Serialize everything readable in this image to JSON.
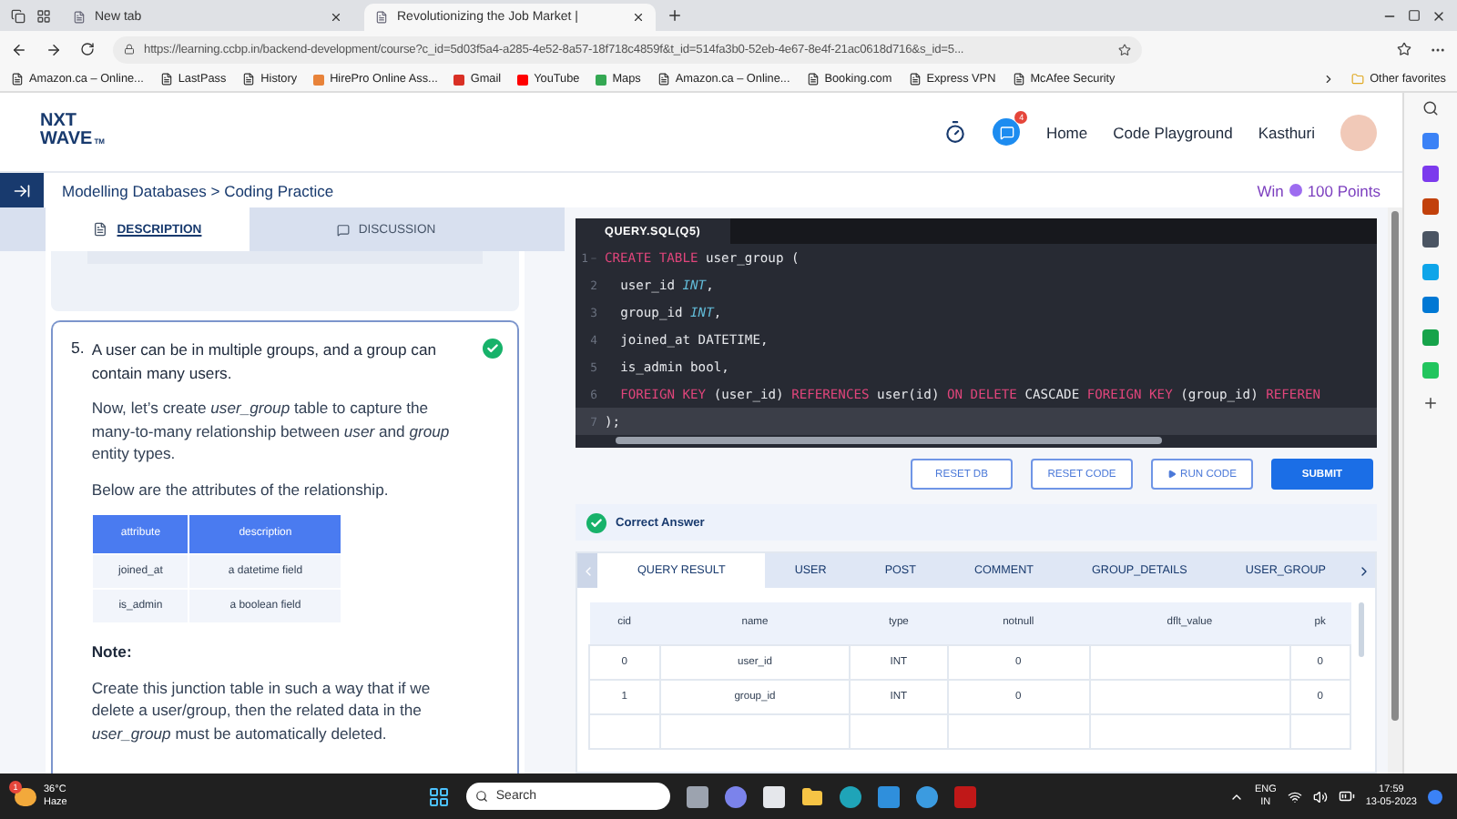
{
  "browser": {
    "tabs": [
      {
        "title": "New tab",
        "selected": false
      },
      {
        "title": "Revolutionizing the Job Market |",
        "selected": true
      }
    ],
    "url": "https://learning.ccbp.in/backend-development/course?c_id=5d03f5a4-a285-4e52-8a57-18f718c4859f&t_id=514fa3b0-52eb-4e67-8e4f-21ac0618d716&s_id=5...",
    "bookmarks": [
      {
        "label": "Amazon.ca – Online...",
        "kind": "page"
      },
      {
        "label": "LastPass",
        "kind": "page"
      },
      {
        "label": "History",
        "kind": "page"
      },
      {
        "label": "HirePro Online Ass...",
        "kind": "site",
        "color": "#e8833a"
      },
      {
        "label": "Gmail",
        "kind": "site",
        "color": "#d93025"
      },
      {
        "label": "YouTube",
        "kind": "site",
        "color": "#ff0000"
      },
      {
        "label": "Maps",
        "kind": "site",
        "color": "#34a853"
      },
      {
        "label": "Amazon.ca – Online...",
        "kind": "page"
      },
      {
        "label": "Booking.com",
        "kind": "page"
      },
      {
        "label": "Express VPN",
        "kind": "page"
      },
      {
        "label": "McAfee Security",
        "kind": "page"
      }
    ],
    "other_favorites": "Other favorites"
  },
  "header": {
    "logo_lines": [
      "NXT",
      "WAVE"
    ],
    "logo_mark": "TM",
    "notification_count": "4",
    "nav": [
      "Home",
      "Code Playground"
    ],
    "user": "Kasthuri"
  },
  "breadcrumb": "Modelling Databases > Coding Practice",
  "reward": {
    "prefix": "Win",
    "points": "100 Points"
  },
  "description_tabs": [
    {
      "label": "DESCRIPTION",
      "selected": true
    },
    {
      "label": "DISCUSSION",
      "selected": false
    }
  ],
  "question": {
    "number": "5.",
    "completed": true,
    "title": "A user can be in multiple groups, and a group can contain many users.",
    "paragraphs": [
      "Now, let’s create *user_group* table to capture the many-to-many relationship between *user* and *group* entity types.",
      "Below are the attributes of the relationship."
    ],
    "attributes_table": {
      "columns": [
        "attribute",
        "description"
      ],
      "rows": [
        [
          "joined_at",
          "a datetime field"
        ],
        [
          "is_admin",
          "a boolean field"
        ]
      ]
    },
    "note_heading": "Note:",
    "note": "Create this junction table in such a way that if we delete a user/group, then the related data in the *user_group* must be automatically deleted."
  },
  "editor": {
    "file_tab": "QUERY.SQL(Q5)",
    "lines": [
      {
        "number": "1",
        "foldable": true,
        "active": false,
        "indented": false,
        "tokens": [
          {
            "kind": "keyword",
            "text": "CREATE TABLE"
          },
          {
            "kind": "plain",
            "text": " user_group ("
          }
        ]
      },
      {
        "number": "2",
        "foldable": false,
        "active": false,
        "indented": true,
        "tokens": [
          {
            "kind": "plain",
            "text": "user_id "
          },
          {
            "kind": "type",
            "text": "INT"
          },
          {
            "kind": "plain",
            "text": ","
          }
        ]
      },
      {
        "number": "3",
        "foldable": false,
        "active": false,
        "indented": true,
        "tokens": [
          {
            "kind": "plain",
            "text": "group_id "
          },
          {
            "kind": "type",
            "text": "INT"
          },
          {
            "kind": "plain",
            "text": ","
          }
        ]
      },
      {
        "number": "4",
        "foldable": false,
        "active": false,
        "indented": true,
        "tokens": [
          {
            "kind": "plain",
            "text": "joined_at DATETIME,"
          }
        ]
      },
      {
        "number": "5",
        "foldable": false,
        "active": false,
        "indented": true,
        "tokens": [
          {
            "kind": "plain",
            "text": "is_admin bool,"
          }
        ]
      },
      {
        "number": "6",
        "foldable": false,
        "active": false,
        "indented": true,
        "tokens": [
          {
            "kind": "keyword",
            "text": "FOREIGN KEY"
          },
          {
            "kind": "plain",
            "text": " (user_id) "
          },
          {
            "kind": "keyword",
            "text": "REFERENCES"
          },
          {
            "kind": "plain",
            "text": " user(id) "
          },
          {
            "kind": "keyword",
            "text": "ON DELETE"
          },
          {
            "kind": "plain",
            "text": " CASCADE "
          },
          {
            "kind": "keyword",
            "text": "FOREIGN KEY"
          },
          {
            "kind": "plain",
            "text": " (group_id) "
          },
          {
            "kind": "keyword",
            "text": "REFEREN"
          }
        ]
      },
      {
        "number": "7",
        "foldable": false,
        "active": true,
        "indented": false,
        "tokens": [
          {
            "kind": "plain",
            "text": ");"
          }
        ]
      }
    ]
  },
  "actions": [
    {
      "label": "RESET DB",
      "kind": "outline"
    },
    {
      "label": "RESET CODE",
      "kind": "outline"
    },
    {
      "label": "RUN CODE",
      "kind": "run"
    },
    {
      "label": "SUBMIT",
      "kind": "primary"
    }
  ],
  "status": {
    "kind": "success",
    "message": "Correct Answer"
  },
  "result_tabs": [
    {
      "label": "QUERY RESULT",
      "selected": true
    },
    {
      "label": "USER",
      "selected": false
    },
    {
      "label": "POST",
      "selected": false
    },
    {
      "label": "COMMENT",
      "selected": false
    },
    {
      "label": "GROUP_DETAILS",
      "selected": false
    },
    {
      "label": "USER_GROUP",
      "selected": false
    }
  ],
  "result_table": {
    "columns": [
      "cid",
      "name",
      "type",
      "notnull",
      "dflt_value",
      "pk"
    ],
    "rows": [
      [
        "0",
        "user_id",
        "INT",
        "0",
        null,
        "0"
      ],
      [
        "1",
        "group_id",
        "INT",
        "0",
        null,
        "0"
      ]
    ]
  },
  "taskbar": {
    "temperature": "36°C",
    "condition": "Haze",
    "alert_count": "1",
    "search_placeholder": "Search",
    "language": [
      "ENG",
      "IN"
    ],
    "time": "17:59",
    "date": "13-05-2023"
  }
}
